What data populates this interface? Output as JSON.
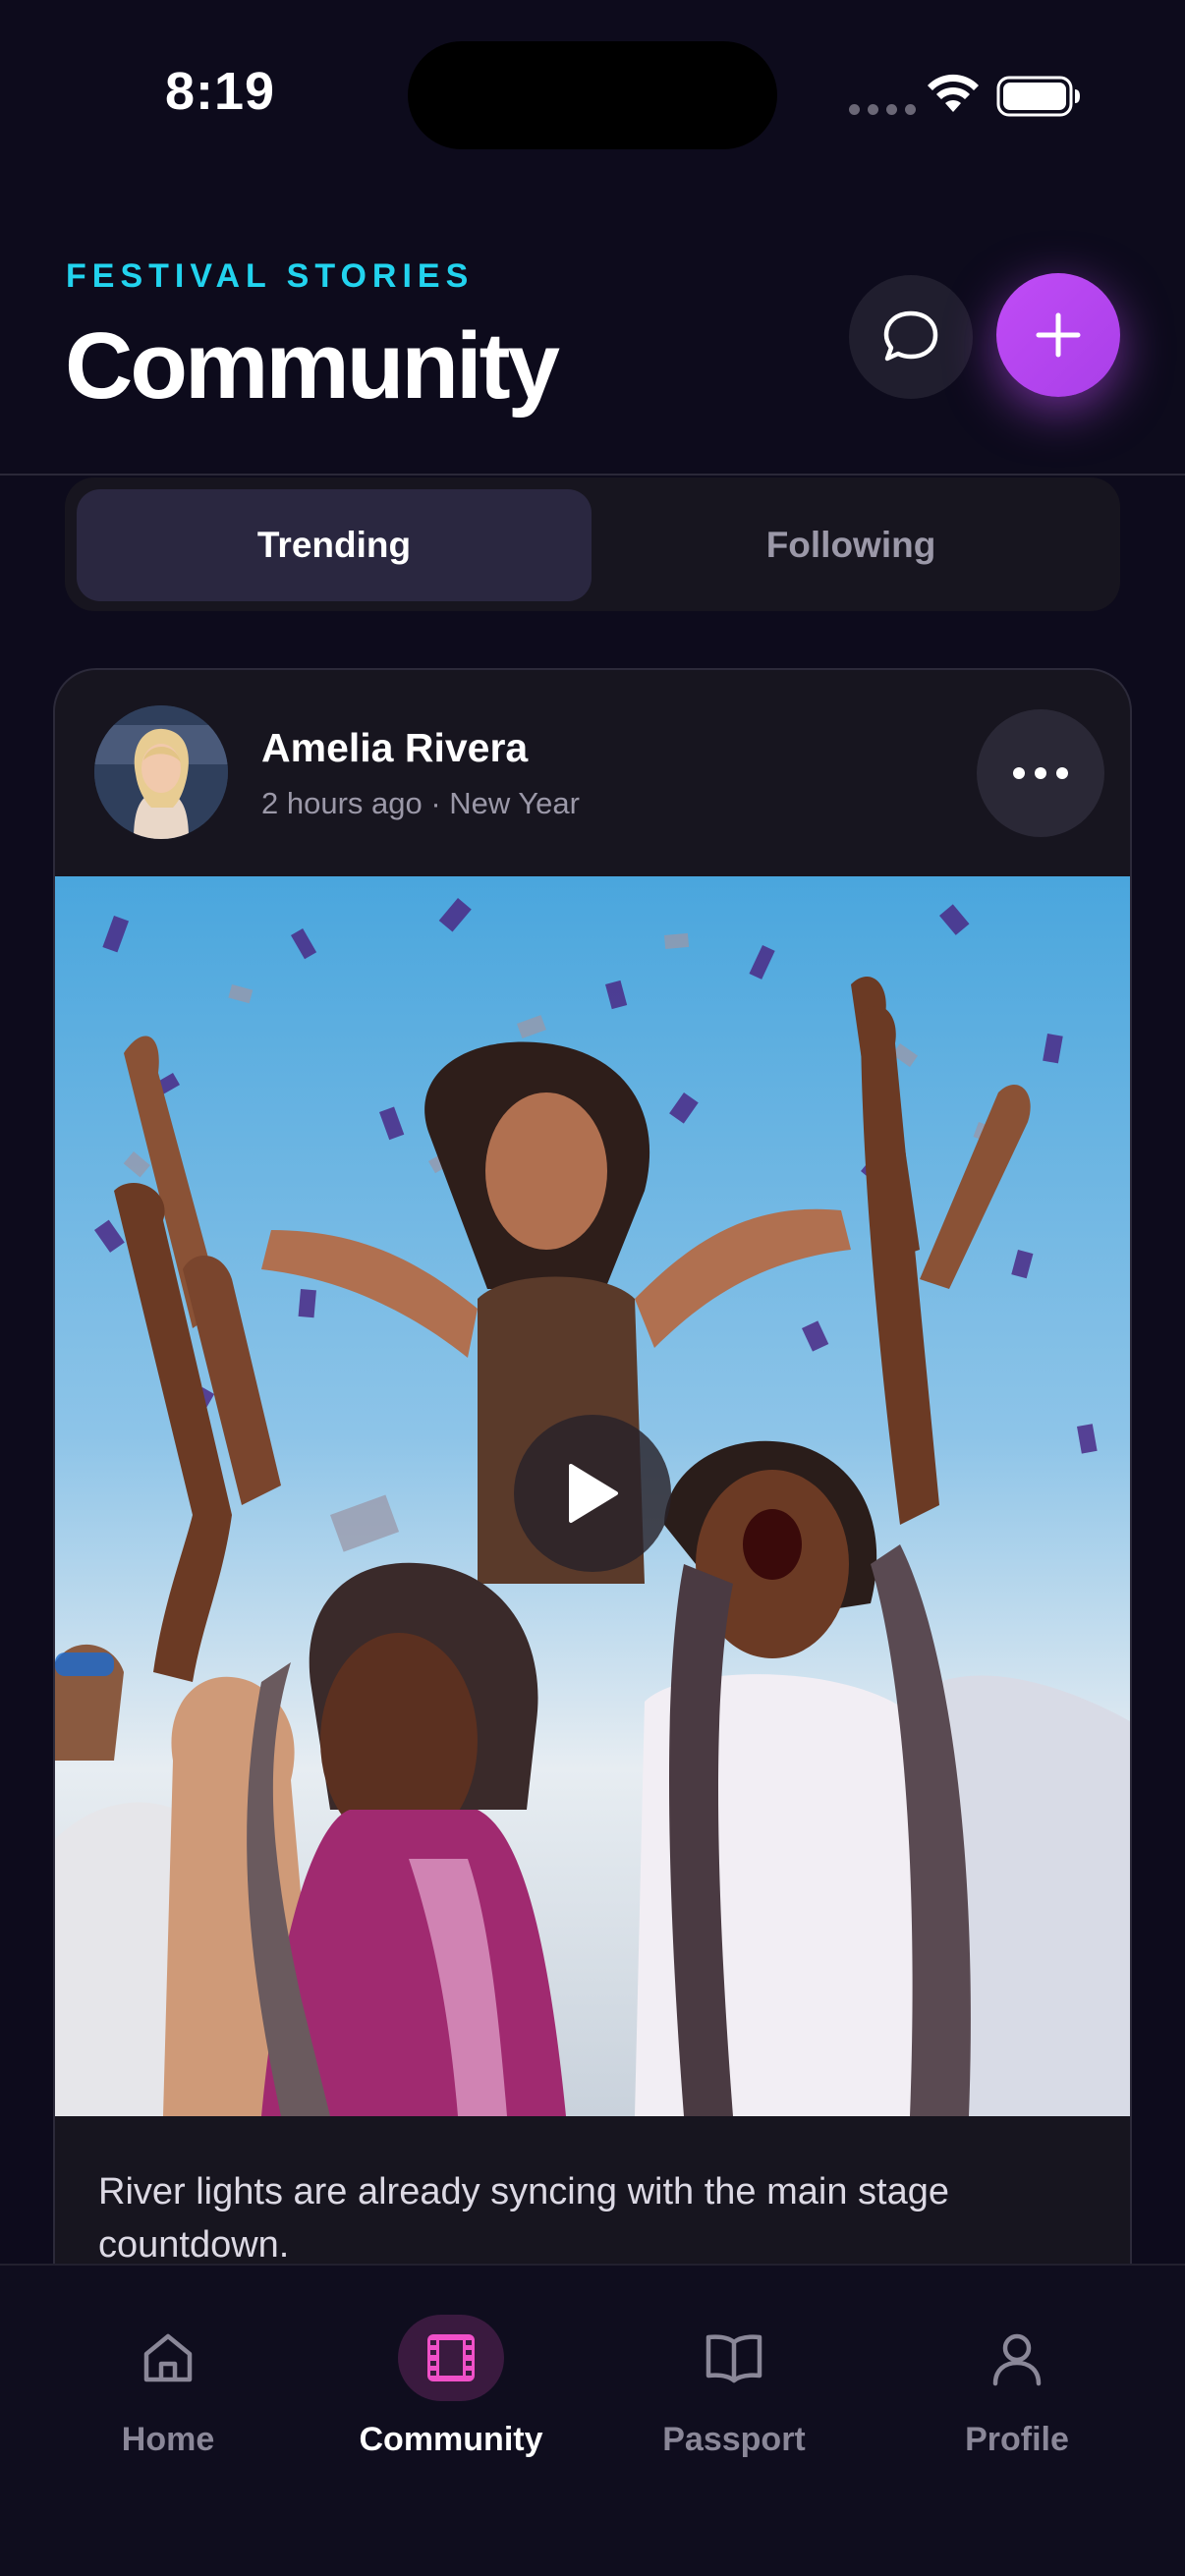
{
  "status_bar": {
    "time": "8:19"
  },
  "header": {
    "eyebrow": "FESTIVAL STORIES",
    "title": "Community"
  },
  "tabs": [
    {
      "label": "Trending",
      "active": true
    },
    {
      "label": "Following",
      "active": false
    }
  ],
  "post": {
    "author": "Amelia Rivera",
    "meta": "2 hours ago · New Year",
    "caption": "River lights are already syncing with the main stage countdown."
  },
  "bottom_nav": [
    {
      "label": "Home",
      "icon": "home-icon",
      "active": false
    },
    {
      "label": "Community",
      "icon": "film-icon",
      "active": true
    },
    {
      "label": "Passport",
      "icon": "book-open-icon",
      "active": false
    },
    {
      "label": "Profile",
      "icon": "user-icon",
      "active": false
    }
  ],
  "colors": {
    "background": "#0d0b1c",
    "accent_cyan": "#22d3ee",
    "accent_purple": "#c04cf6",
    "accent_pink": "#f050c8"
  }
}
